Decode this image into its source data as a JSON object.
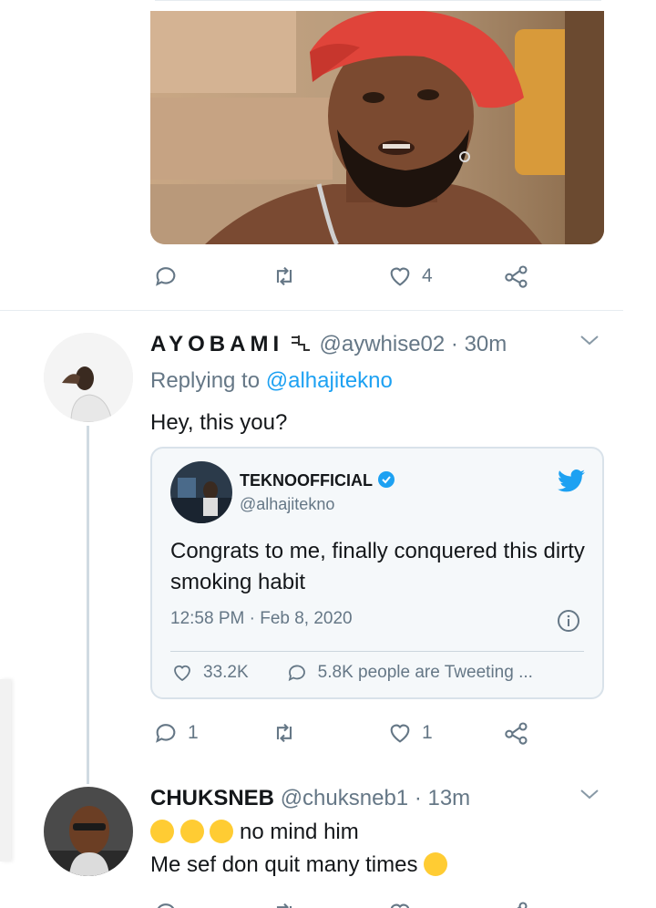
{
  "first_tweet": {
    "actions": {
      "reply_count": "",
      "retweet_count": "",
      "like_count": "4"
    }
  },
  "reply": {
    "display_name": "AYOBAMI",
    "handle": "@aywhise02",
    "time": "· 30m",
    "replying_prefix": "Replying to",
    "replying_to": "@alhajitekno",
    "text": "Hey, this you?",
    "quoted": {
      "display_name": "TEKNOOFFICIAL",
      "handle": "@alhajitekno",
      "text": "Congrats to me, finally conquered this dirty smoking habit",
      "timestamp": "12:58 PM · Feb 8, 2020",
      "likes": "33.2K",
      "tweeting": "5.8K people are Tweeting ..."
    },
    "actions": {
      "reply_count": "1",
      "like_count": "1"
    }
  },
  "second_reply": {
    "display_name": "CHUKSNEB",
    "handle": "@chuksneb1",
    "time": "· 13m",
    "line1": "no mind him",
    "line2": "Me sef don quit many times"
  },
  "colors": {
    "link": "#1da1f2",
    "muted": "#657786",
    "verified": "#1da1f2",
    "twitter_bird": "#1da1f2"
  }
}
